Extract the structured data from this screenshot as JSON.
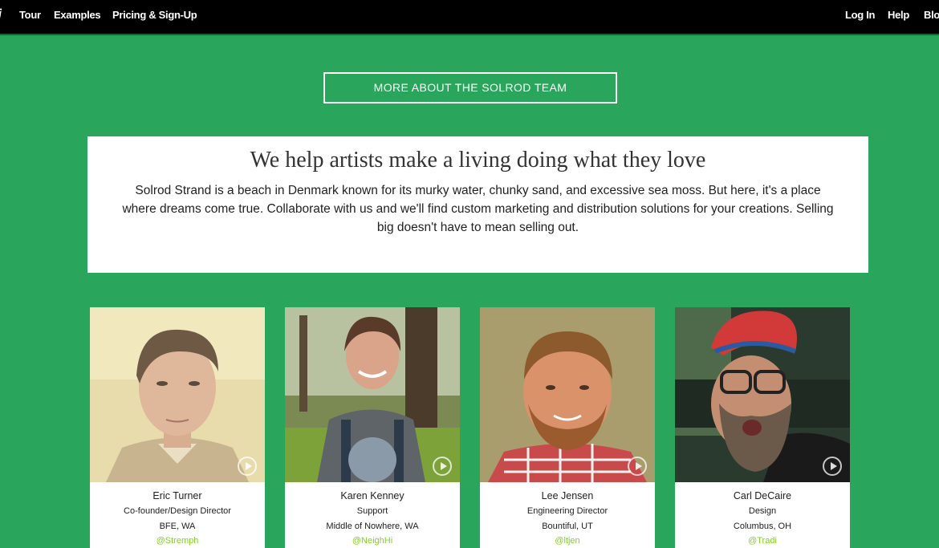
{
  "nav": {
    "logo_fragment": "j",
    "left": [
      "Tour",
      "Examples",
      "Pricing & Sign-Up"
    ],
    "right": [
      "Log In",
      "Help",
      "Blo"
    ]
  },
  "team_button": "MORE ABOUT THE SOLROD TEAM",
  "hero": {
    "title": "We help artists make a living doing what they love",
    "body": "Solrod Strand is a beach in Denmark known for its murky water, chunky sand, and excessive sea moss. But here, it's a place where dreams come true. Collaborate with us and we'll find custom marketing and distribution solutions for your creations. Selling big doesn't have to mean selling out."
  },
  "team": [
    {
      "name": "Eric Turner",
      "role": "Co-founder/Design Director",
      "location": "BFE, WA",
      "handle": "@Stremph"
    },
    {
      "name": "Karen Kenney",
      "role": "Support",
      "location": "Middle of Nowhere, WA",
      "handle": "@NeighHi"
    },
    {
      "name": "Lee Jensen",
      "role": "Engineering Director",
      "location": "Bountiful, UT",
      "handle": "@ltjen"
    },
    {
      "name": "Carl DeCaire",
      "role": "Design",
      "location": "Columbus, OH",
      "handle": "@Tradi"
    }
  ],
  "colors": {
    "background": "#29a65b",
    "topbar": "#000000",
    "handle_link": "#7ed321"
  },
  "icons": [
    "play-icon"
  ]
}
